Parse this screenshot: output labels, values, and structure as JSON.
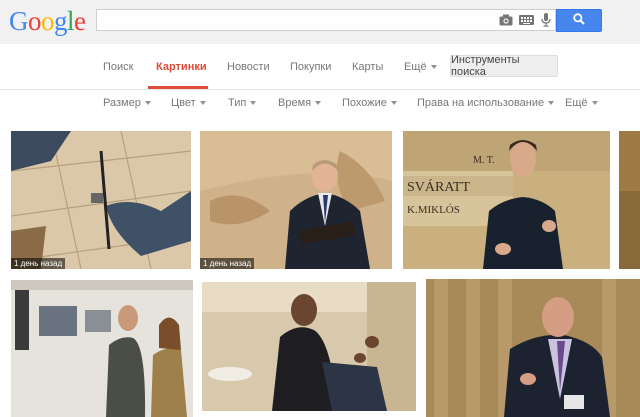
{
  "logo": {
    "letters": [
      "G",
      "o",
      "o",
      "g",
      "l",
      "e"
    ],
    "colors": [
      "#4285f4",
      "#ea4335",
      "#fbbc05",
      "#4285f4",
      "#34a853",
      "#ea4335"
    ]
  },
  "search": {
    "value": "",
    "placeholder": ""
  },
  "icons": {
    "camera": "camera-icon",
    "keyboard": "keyboard-icon",
    "mic": "microphone-icon",
    "search": "search-icon"
  },
  "nav": {
    "items": [
      "Поиск",
      "Картинки",
      "Новости",
      "Покупки",
      "Карты",
      "Ещё"
    ],
    "active_index": 1,
    "tools": "Инструменты поиска"
  },
  "filters": [
    "Размер",
    "Цвет",
    "Тип",
    "Время",
    "Похожие",
    "Права на использование",
    "Ещё"
  ],
  "results": {
    "row1": [
      {
        "label": "1 день назад"
      },
      {
        "label": "1 день назад"
      },
      {
        "label": ""
      }
    ]
  },
  "colors": {
    "accent": "#dd4b39",
    "search_button": "#4787ed",
    "topbar": "#f1f1f1"
  }
}
